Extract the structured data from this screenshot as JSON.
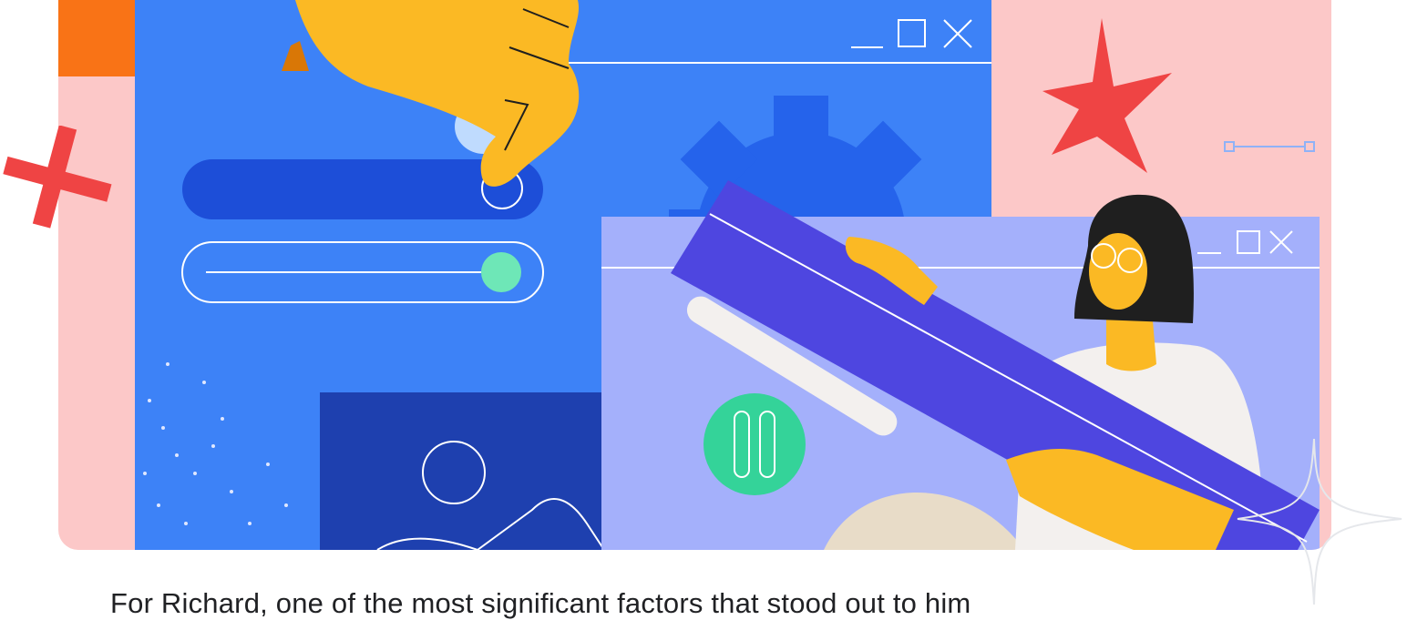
{
  "caption": {
    "text": "For Richard, one of the most significant factors that stood out to him"
  },
  "colors": {
    "card_bg": "#fcc8c8",
    "window_blue": "#3d82f7",
    "window_lavender": "#a4b0fb",
    "ruler_purple": "#4e46e0",
    "hand_yellow": "#fbb924",
    "pause_green": "#34d399",
    "accent_red": "#ef4444"
  },
  "icons": {
    "main_window_controls": [
      "minimize-icon",
      "maximize-icon",
      "close-icon"
    ],
    "second_window_controls": [
      "minimize-icon",
      "maximize-icon",
      "close-icon"
    ],
    "pause": "pause-icon",
    "settings": "gear-icon"
  }
}
